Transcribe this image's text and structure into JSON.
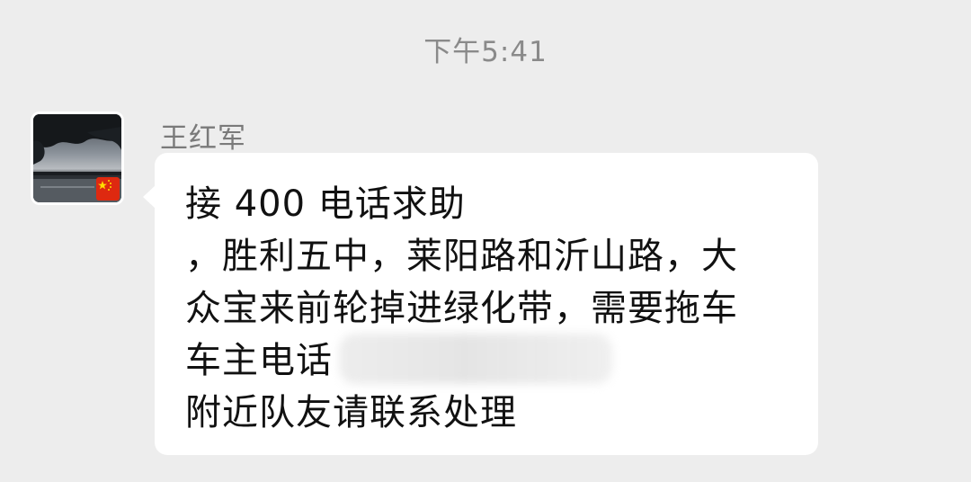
{
  "chat": {
    "timestamp": "下午5:41"
  },
  "message": {
    "sender_name": "王红军",
    "avatar_icon": "profile-photo-icon",
    "badge_icon": "china-flag-icon",
    "lines": [
      "接 400 电话求助",
      "，胜利五中，莱阳路和沂山路，大",
      "众宝来前轮掉进绿化带，需要拖车",
      "车主电话",
      "附近队友请联系处理"
    ]
  },
  "colors": {
    "background": "#ededed",
    "bubble": "#ffffff",
    "timestamp_text": "#8a8a8a",
    "sender_text": "#7a7a7a",
    "message_text": "#111111",
    "flag_red": "#de2910",
    "flag_star": "#ffde00"
  }
}
